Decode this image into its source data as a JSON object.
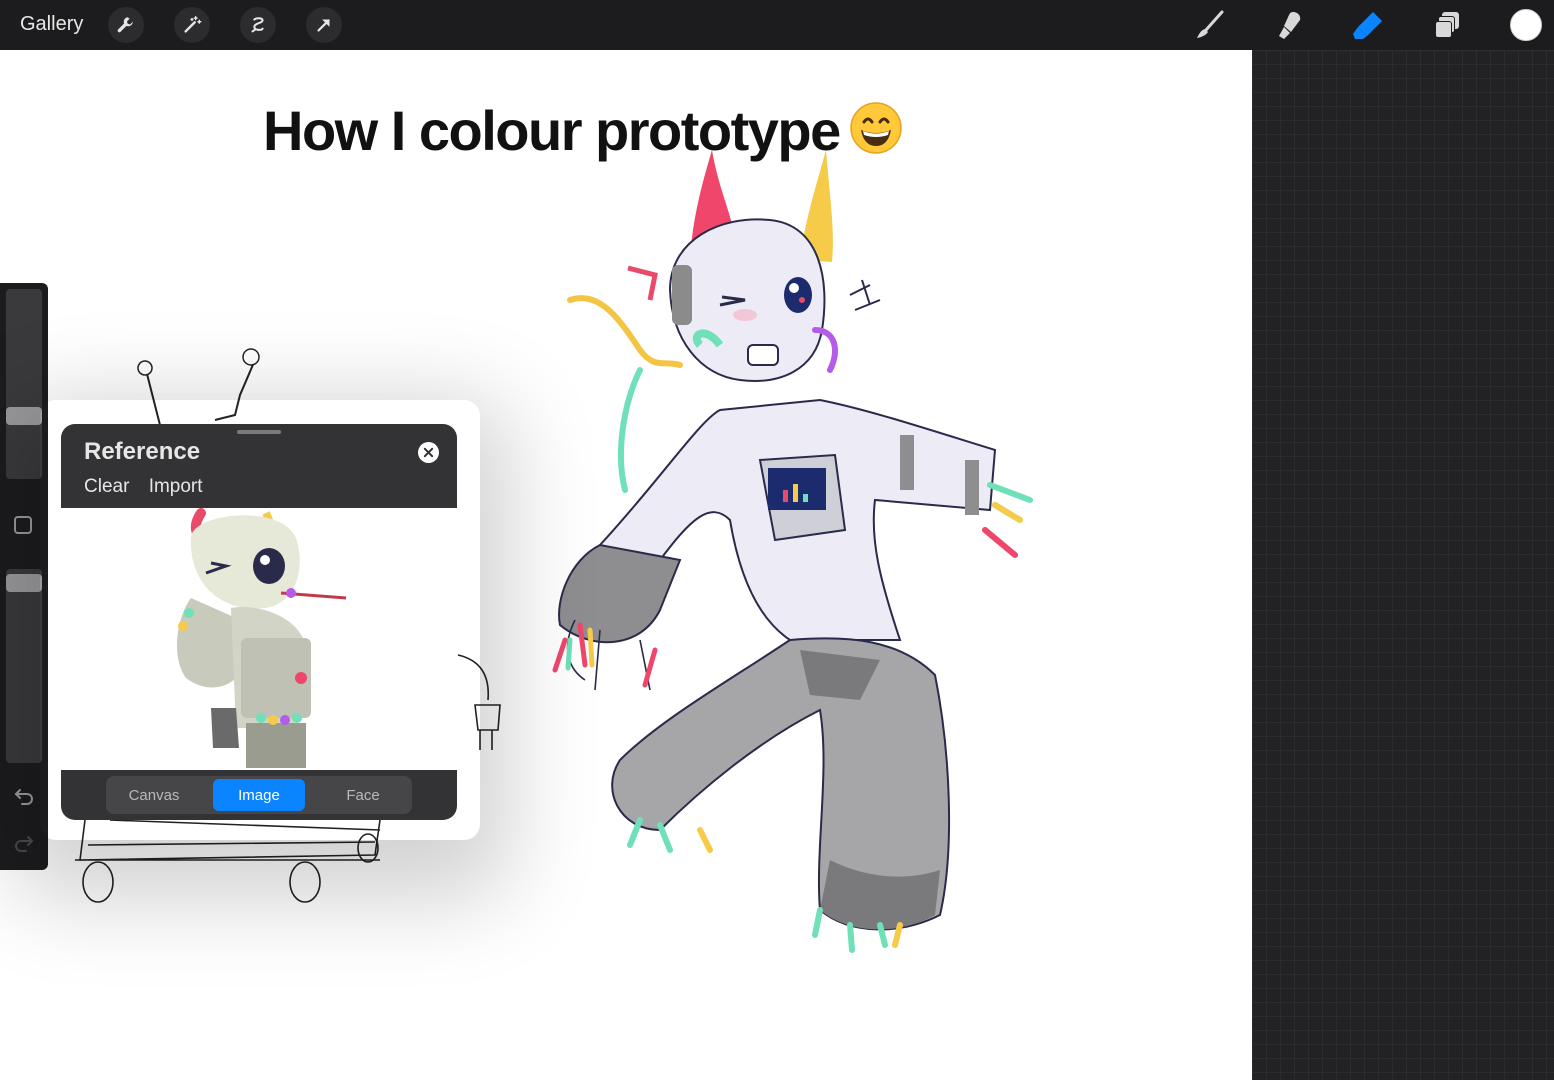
{
  "toolbar": {
    "gallery_label": "Gallery",
    "left_tools": [
      "wrench-icon",
      "magic-wand-icon",
      "selection-icon",
      "transform-arrow-icon"
    ],
    "right_tools": [
      "brush-icon",
      "smudge-icon",
      "eraser-icon",
      "layers-icon"
    ],
    "active_tool": "eraser-icon",
    "accent_color": "#0a84ff",
    "current_color": "#ffffff"
  },
  "canvas": {
    "headline": "How I colour prototype",
    "emoji": "grinning-face-emoji"
  },
  "sidebar": {
    "icons": [
      "undo-icon",
      "redo-icon",
      "modify-square-icon"
    ]
  },
  "reference": {
    "title": "Reference",
    "actions": [
      "Clear",
      "Import"
    ],
    "tabs": [
      "Canvas",
      "Image",
      "Face"
    ],
    "active_tab": "Image"
  }
}
